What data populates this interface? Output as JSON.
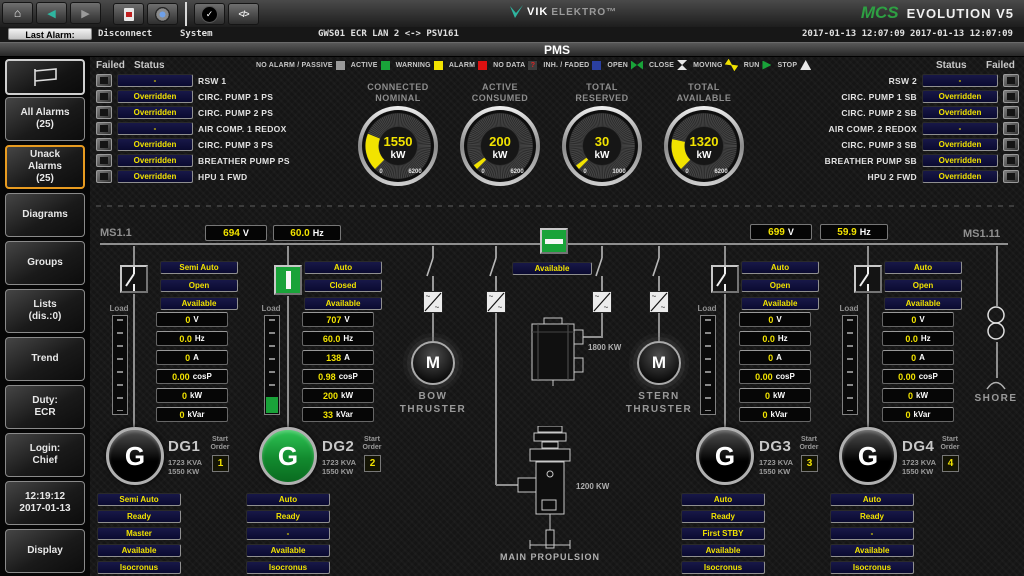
{
  "toolbar": {
    "icons": [
      {
        "name": "home-icon",
        "glyph": "⌂"
      },
      {
        "name": "back-icon",
        "glyph": "◀"
      },
      {
        "name": "forward-icon",
        "glyph": "▶"
      },
      {
        "name": "ack-check-icon",
        "glyph": "✓"
      },
      {
        "name": "code-icon",
        "glyph": "</>"
      }
    ],
    "brand_vik": "VIK",
    "brand_elektro": "ELEKTRO™",
    "product_mcs": "MCS",
    "product_name": "EVOLUTION V5"
  },
  "alarm_bar": {
    "last_alarm_label": "Last Alarm:",
    "alarm_text": "Disconnect",
    "source": "System",
    "connection": "GWS01 ECR LAN 2 <-> PSV161",
    "timestamp_left": "2017-01-13 12:07:09",
    "timestamp_right": "2017-01-13 12:07:09"
  },
  "title_bar": {
    "title": "PMS"
  },
  "sidebar": {
    "items": [
      {
        "l1": "All Alarms",
        "l2": "(25)"
      },
      {
        "l1": "Unack Alarms",
        "l2": "(25)",
        "active": true
      },
      {
        "l1": "Diagrams",
        "l2": ""
      },
      {
        "l1": "Groups",
        "l2": ""
      },
      {
        "l1": "Lists",
        "l2": "(dis.:0)"
      },
      {
        "l1": "Trend",
        "l2": ""
      },
      {
        "l1": "Duty:",
        "l2": "ECR"
      },
      {
        "l1": "Login:",
        "l2": "Chief"
      },
      {
        "l1": "12:19:12",
        "l2": "2017-01-13"
      },
      {
        "l1": "Display",
        "l2": ""
      }
    ]
  },
  "legend": {
    "items": [
      {
        "label": "NO ALARM / PASSIVE"
      },
      {
        "label": "ACTIVE"
      },
      {
        "label": "WARNING"
      },
      {
        "label": "ALARM"
      },
      {
        "label": "NO DATA",
        "glyph": "?"
      },
      {
        "label": "INH. / FADED"
      },
      {
        "label": "OPEN"
      },
      {
        "label": "CLOSE"
      },
      {
        "label": "MOVING"
      },
      {
        "label": "RUN"
      },
      {
        "label": "STOP"
      }
    ]
  },
  "status_left": {
    "failed_header": "Failed",
    "status_header": "Status",
    "rows": [
      {
        "status": "-",
        "name": "RSW 1"
      },
      {
        "status": "Overridden",
        "name": "CIRC. PUMP 1 PS"
      },
      {
        "status": "Overridden",
        "name": "CIRC. PUMP 2 PS"
      },
      {
        "status": "-",
        "name": "AIR COMP. 1 REDOX"
      },
      {
        "status": "Overridden",
        "name": "CIRC. PUMP 3 PS"
      },
      {
        "status": "Overridden",
        "name": "BREATHER PUMP PS"
      },
      {
        "status": "Overridden",
        "name": "HPU 1 FWD"
      }
    ]
  },
  "status_right": {
    "failed_header": "Failed",
    "status_header": "Status",
    "rows": [
      {
        "status": "-",
        "name": "RSW 2"
      },
      {
        "status": "Overridden",
        "name": "CIRC. PUMP 1 SB"
      },
      {
        "status": "Overridden",
        "name": "CIRC. PUMP 2 SB"
      },
      {
        "status": "-",
        "name": "AIR COMP. 2 REDOX"
      },
      {
        "status": "Overridden",
        "name": "CIRC. PUMP 3 SB"
      },
      {
        "status": "Overridden",
        "name": "BREATHER PUMP SB"
      },
      {
        "status": "Overridden",
        "name": "HPU 2 FWD"
      }
    ]
  },
  "gauges": [
    {
      "title1": "CONNECTED",
      "title2": "NOMINAL",
      "value": "1550",
      "unit": "kW",
      "min": "0",
      "max": "6200",
      "numeric_value": 1550,
      "numeric_max": 6200
    },
    {
      "title1": "ACTIVE",
      "title2": "CONSUMED",
      "value": "200",
      "unit": "kW",
      "min": "0",
      "max": "6200",
      "numeric_value": 200,
      "numeric_max": 6200
    },
    {
      "title1": "TOTAL",
      "title2": "RESERVED",
      "value": "30",
      "unit": "kW",
      "min": "0",
      "max": "1000",
      "numeric_value": 30,
      "numeric_max": 1000
    },
    {
      "title1": "TOTAL",
      "title2": "AVAILABLE",
      "value": "1320",
      "unit": "kW",
      "min": "0",
      "max": "6200",
      "numeric_value": 1320,
      "numeric_max": 6200
    }
  ],
  "buses": {
    "left": {
      "label": "MS1.1",
      "voltage": "694",
      "voltage_unit": "V",
      "frequency": "60.0",
      "frequency_unit": "Hz"
    },
    "right": {
      "label": "MS1.11",
      "voltage": "699",
      "voltage_unit": "V",
      "frequency": "59.9",
      "frequency_unit": "Hz"
    },
    "tie": {
      "status": "Available"
    }
  },
  "generators": [
    {
      "symbol": "G",
      "name": "DG1",
      "rating_kva": "1723 KVA",
      "rating_kw": "1550 KW",
      "start_l1": "Start",
      "start_l2": "Order",
      "start_order": "1",
      "load_label": "Load",
      "breaker_state": "open",
      "top_states": [
        "Semi Auto",
        "Open",
        "Available"
      ],
      "meters": [
        {
          "v": "0",
          "u": "V"
        },
        {
          "v": "0.0",
          "u": "Hz"
        },
        {
          "v": "0",
          "u": "A"
        },
        {
          "v": "0.00",
          "u": "cosP"
        },
        {
          "v": "0",
          "u": "kW"
        },
        {
          "v": "0",
          "u": "kVar"
        }
      ],
      "bottom_states": [
        "Semi Auto",
        "Ready",
        "Master",
        "Available",
        "Isocronus"
      ]
    },
    {
      "symbol": "G",
      "name": "DG2",
      "rating_kva": "1723 KVA",
      "rating_kw": "1550 KW",
      "start_l1": "Start",
      "start_l2": "Order",
      "start_order": "2",
      "load_label": "Load",
      "breaker_state": "closed",
      "running": true,
      "top_states": [
        "Auto",
        "Closed",
        "Available"
      ],
      "meters": [
        {
          "v": "707",
          "u": "V"
        },
        {
          "v": "60.0",
          "u": "Hz"
        },
        {
          "v": "138",
          "u": "A"
        },
        {
          "v": "0.98",
          "u": "cosP"
        },
        {
          "v": "200",
          "u": "kW"
        },
        {
          "v": "33",
          "u": "kVar"
        }
      ],
      "bottom_states": [
        "Auto",
        "Ready",
        "-",
        "Available",
        "Isocronus"
      ]
    },
    {
      "symbol": "G",
      "name": "DG3",
      "rating_kva": "1723 KVA",
      "rating_kw": "1550 KW",
      "start_l1": "Start",
      "start_l2": "Order",
      "start_order": "3",
      "load_label": "Load",
      "breaker_state": "open",
      "top_states": [
        "Auto",
        "Open",
        "Available"
      ],
      "meters": [
        {
          "v": "0",
          "u": "V"
        },
        {
          "v": "0.0",
          "u": "Hz"
        },
        {
          "v": "0",
          "u": "A"
        },
        {
          "v": "0.00",
          "u": "cosP"
        },
        {
          "v": "0",
          "u": "kW"
        },
        {
          "v": "0",
          "u": "kVar"
        }
      ],
      "bottom_states": [
        "Auto",
        "Ready",
        "First STBY",
        "Available",
        "Isocronus"
      ]
    },
    {
      "symbol": "G",
      "name": "DG4",
      "rating_kva": "1723 KVA",
      "rating_kw": "1550 KW",
      "start_l1": "Start",
      "start_l2": "Order",
      "start_order": "4",
      "load_label": "Load",
      "breaker_state": "open",
      "top_states": [
        "Auto",
        "Open",
        "Available"
      ],
      "meters": [
        {
          "v": "0",
          "u": "V"
        },
        {
          "v": "0.0",
          "u": "Hz"
        },
        {
          "v": "0",
          "u": "A"
        },
        {
          "v": "0.00",
          "u": "cosP"
        },
        {
          "v": "0",
          "u": "kW"
        },
        {
          "v": "0",
          "u": "kVar"
        }
      ],
      "bottom_states": [
        "Auto",
        "Ready",
        "-",
        "Available",
        "Isocronus"
      ]
    }
  ],
  "thrusters": {
    "motor_symbol": "M",
    "bow_l1": "BOW",
    "bow_l2": "THRUSTER",
    "stern_l1": "STERN",
    "stern_l2": "THRUSTER"
  },
  "propulsion": {
    "motor_power": "1800 KW",
    "gear_power": "1200 KW",
    "label": "MAIN PROPULSION"
  },
  "shore": {
    "label": "SHORE"
  },
  "colors": {
    "accent_teal": "#2fb5a0",
    "brand_green": "#2ea043",
    "status_green": "#19a339",
    "warning_yellow": "#f2e300",
    "alarm_red": "#dd1111",
    "inhibit_blue": "#2a3fa0",
    "value_yellow": "#f2e300",
    "panel_navy": "#10103a",
    "highlight_orange": "#e89b20"
  }
}
